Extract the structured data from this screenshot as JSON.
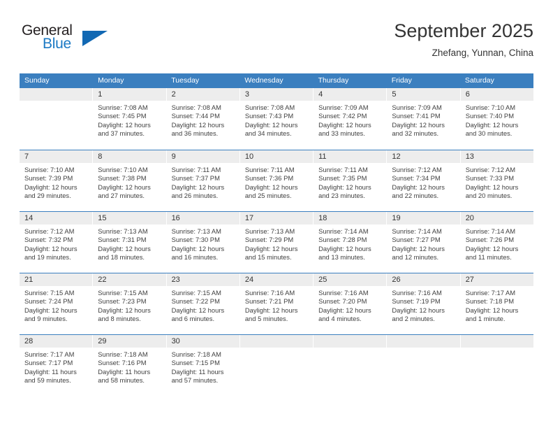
{
  "logo": {
    "word_top": "General",
    "word_bottom": "Blue",
    "triangle_color": "#1168b3",
    "blue_color": "#1b79c4"
  },
  "header": {
    "title": "September 2025",
    "subtitle": "Zhefang, Yunnan, China",
    "header_bg_color": "#3b7fbf",
    "header_text_color": "#ffffff"
  },
  "weekdays": [
    "Sunday",
    "Monday",
    "Tuesday",
    "Wednesday",
    "Thursday",
    "Friday",
    "Saturday"
  ],
  "weeks": [
    [
      {
        "day": "",
        "sunrise": "",
        "sunset": "",
        "daylight_line1": "",
        "daylight_line2": ""
      },
      {
        "day": "1",
        "sunrise": "Sunrise: 7:08 AM",
        "sunset": "Sunset: 7:45 PM",
        "daylight_line1": "Daylight: 12 hours",
        "daylight_line2": "and 37 minutes."
      },
      {
        "day": "2",
        "sunrise": "Sunrise: 7:08 AM",
        "sunset": "Sunset: 7:44 PM",
        "daylight_line1": "Daylight: 12 hours",
        "daylight_line2": "and 36 minutes."
      },
      {
        "day": "3",
        "sunrise": "Sunrise: 7:08 AM",
        "sunset": "Sunset: 7:43 PM",
        "daylight_line1": "Daylight: 12 hours",
        "daylight_line2": "and 34 minutes."
      },
      {
        "day": "4",
        "sunrise": "Sunrise: 7:09 AM",
        "sunset": "Sunset: 7:42 PM",
        "daylight_line1": "Daylight: 12 hours",
        "daylight_line2": "and 33 minutes."
      },
      {
        "day": "5",
        "sunrise": "Sunrise: 7:09 AM",
        "sunset": "Sunset: 7:41 PM",
        "daylight_line1": "Daylight: 12 hours",
        "daylight_line2": "and 32 minutes."
      },
      {
        "day": "6",
        "sunrise": "Sunrise: 7:10 AM",
        "sunset": "Sunset: 7:40 PM",
        "daylight_line1": "Daylight: 12 hours",
        "daylight_line2": "and 30 minutes."
      }
    ],
    [
      {
        "day": "7",
        "sunrise": "Sunrise: 7:10 AM",
        "sunset": "Sunset: 7:39 PM",
        "daylight_line1": "Daylight: 12 hours",
        "daylight_line2": "and 29 minutes."
      },
      {
        "day": "8",
        "sunrise": "Sunrise: 7:10 AM",
        "sunset": "Sunset: 7:38 PM",
        "daylight_line1": "Daylight: 12 hours",
        "daylight_line2": "and 27 minutes."
      },
      {
        "day": "9",
        "sunrise": "Sunrise: 7:11 AM",
        "sunset": "Sunset: 7:37 PM",
        "daylight_line1": "Daylight: 12 hours",
        "daylight_line2": "and 26 minutes."
      },
      {
        "day": "10",
        "sunrise": "Sunrise: 7:11 AM",
        "sunset": "Sunset: 7:36 PM",
        "daylight_line1": "Daylight: 12 hours",
        "daylight_line2": "and 25 minutes."
      },
      {
        "day": "11",
        "sunrise": "Sunrise: 7:11 AM",
        "sunset": "Sunset: 7:35 PM",
        "daylight_line1": "Daylight: 12 hours",
        "daylight_line2": "and 23 minutes."
      },
      {
        "day": "12",
        "sunrise": "Sunrise: 7:12 AM",
        "sunset": "Sunset: 7:34 PM",
        "daylight_line1": "Daylight: 12 hours",
        "daylight_line2": "and 22 minutes."
      },
      {
        "day": "13",
        "sunrise": "Sunrise: 7:12 AM",
        "sunset": "Sunset: 7:33 PM",
        "daylight_line1": "Daylight: 12 hours",
        "daylight_line2": "and 20 minutes."
      }
    ],
    [
      {
        "day": "14",
        "sunrise": "Sunrise: 7:12 AM",
        "sunset": "Sunset: 7:32 PM",
        "daylight_line1": "Daylight: 12 hours",
        "daylight_line2": "and 19 minutes."
      },
      {
        "day": "15",
        "sunrise": "Sunrise: 7:13 AM",
        "sunset": "Sunset: 7:31 PM",
        "daylight_line1": "Daylight: 12 hours",
        "daylight_line2": "and 18 minutes."
      },
      {
        "day": "16",
        "sunrise": "Sunrise: 7:13 AM",
        "sunset": "Sunset: 7:30 PM",
        "daylight_line1": "Daylight: 12 hours",
        "daylight_line2": "and 16 minutes."
      },
      {
        "day": "17",
        "sunrise": "Sunrise: 7:13 AM",
        "sunset": "Sunset: 7:29 PM",
        "daylight_line1": "Daylight: 12 hours",
        "daylight_line2": "and 15 minutes."
      },
      {
        "day": "18",
        "sunrise": "Sunrise: 7:14 AM",
        "sunset": "Sunset: 7:28 PM",
        "daylight_line1": "Daylight: 12 hours",
        "daylight_line2": "and 13 minutes."
      },
      {
        "day": "19",
        "sunrise": "Sunrise: 7:14 AM",
        "sunset": "Sunset: 7:27 PM",
        "daylight_line1": "Daylight: 12 hours",
        "daylight_line2": "and 12 minutes."
      },
      {
        "day": "20",
        "sunrise": "Sunrise: 7:14 AM",
        "sunset": "Sunset: 7:26 PM",
        "daylight_line1": "Daylight: 12 hours",
        "daylight_line2": "and 11 minutes."
      }
    ],
    [
      {
        "day": "21",
        "sunrise": "Sunrise: 7:15 AM",
        "sunset": "Sunset: 7:24 PM",
        "daylight_line1": "Daylight: 12 hours",
        "daylight_line2": "and 9 minutes."
      },
      {
        "day": "22",
        "sunrise": "Sunrise: 7:15 AM",
        "sunset": "Sunset: 7:23 PM",
        "daylight_line1": "Daylight: 12 hours",
        "daylight_line2": "and 8 minutes."
      },
      {
        "day": "23",
        "sunrise": "Sunrise: 7:15 AM",
        "sunset": "Sunset: 7:22 PM",
        "daylight_line1": "Daylight: 12 hours",
        "daylight_line2": "and 6 minutes."
      },
      {
        "day": "24",
        "sunrise": "Sunrise: 7:16 AM",
        "sunset": "Sunset: 7:21 PM",
        "daylight_line1": "Daylight: 12 hours",
        "daylight_line2": "and 5 minutes."
      },
      {
        "day": "25",
        "sunrise": "Sunrise: 7:16 AM",
        "sunset": "Sunset: 7:20 PM",
        "daylight_line1": "Daylight: 12 hours",
        "daylight_line2": "and 4 minutes."
      },
      {
        "day": "26",
        "sunrise": "Sunrise: 7:16 AM",
        "sunset": "Sunset: 7:19 PM",
        "daylight_line1": "Daylight: 12 hours",
        "daylight_line2": "and 2 minutes."
      },
      {
        "day": "27",
        "sunrise": "Sunrise: 7:17 AM",
        "sunset": "Sunset: 7:18 PM",
        "daylight_line1": "Daylight: 12 hours",
        "daylight_line2": "and 1 minute."
      }
    ],
    [
      {
        "day": "28",
        "sunrise": "Sunrise: 7:17 AM",
        "sunset": "Sunset: 7:17 PM",
        "daylight_line1": "Daylight: 11 hours",
        "daylight_line2": "and 59 minutes."
      },
      {
        "day": "29",
        "sunrise": "Sunrise: 7:18 AM",
        "sunset": "Sunset: 7:16 PM",
        "daylight_line1": "Daylight: 11 hours",
        "daylight_line2": "and 58 minutes."
      },
      {
        "day": "30",
        "sunrise": "Sunrise: 7:18 AM",
        "sunset": "Sunset: 7:15 PM",
        "daylight_line1": "Daylight: 11 hours",
        "daylight_line2": "and 57 minutes."
      },
      {
        "day": "",
        "sunrise": "",
        "sunset": "",
        "daylight_line1": "",
        "daylight_line2": ""
      },
      {
        "day": "",
        "sunrise": "",
        "sunset": "",
        "daylight_line1": "",
        "daylight_line2": ""
      },
      {
        "day": "",
        "sunrise": "",
        "sunset": "",
        "daylight_line1": "",
        "daylight_line2": ""
      },
      {
        "day": "",
        "sunrise": "",
        "sunset": "",
        "daylight_line1": "",
        "daylight_line2": ""
      }
    ]
  ]
}
